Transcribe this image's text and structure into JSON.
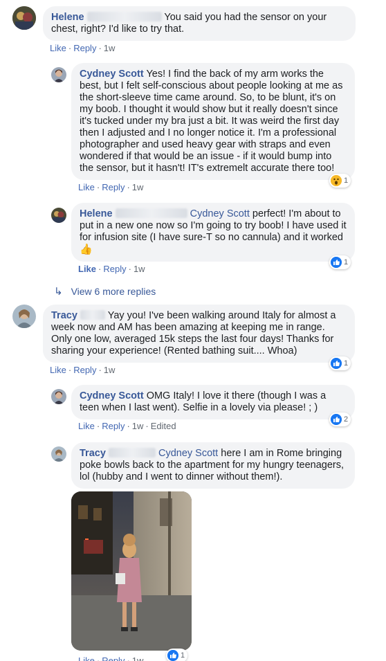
{
  "thread": {
    "c1": {
      "author": "Helene",
      "text": "You said you had the sensor on your chest, right? I'd like to try that.",
      "actions": [
        "Like",
        "Reply"
      ],
      "time": "1w"
    },
    "c2": {
      "author": "Cydney Scott",
      "text": "Yes! I find the back of my arm works the best, but I felt self-conscious about people looking at me as the short-sleeve time came around. So, to be blunt, it's on my boob. I thought it would show but it really doesn't since it's tucked under my bra just a bit. It was weird the first day then I adjusted and I no longer notice it. I'm a professional photographer and used heavy gear with straps and even wondered if that would be an issue - if it would bump into the sensor, but it hasn't! IT's extremelt accurate there too!",
      "actions": [
        "Like",
        "Reply"
      ],
      "time": "1w",
      "reaction": {
        "type": "wow",
        "count": "1"
      }
    },
    "c3": {
      "author": "Helene",
      "mention": "Cydney Scott",
      "text": "perfect! I'm about to put in a new one now so I'm going to try boob! I have used it for infusion site (I have sure-T so no cannula) and it worked",
      "emoji": "👍",
      "actions": [
        "Like",
        "Reply"
      ],
      "time": "1w",
      "reaction": {
        "type": "like",
        "count": "1"
      }
    },
    "view_more": "View 6 more replies",
    "c4": {
      "author": "Tracy",
      "text": "Yay you! I've been walking around Italy for almost a week now and AM has been amazing at keeping me in range. Only one low, averaged 15k steps the last four days! Thanks for sharing your experience! (Rented bathing suit.... Whoa)",
      "actions": [
        "Like",
        "Reply"
      ],
      "time": "1w",
      "reaction": {
        "type": "like",
        "count": "1"
      }
    },
    "c5": {
      "author": "Cydney Scott",
      "text": "OMG Italy! I love it there (though I was a teen when I last went). Selfie in a lovely via please! ; )",
      "actions": [
        "Like",
        "Reply"
      ],
      "time": "1w",
      "edited": "Edited",
      "reaction": {
        "type": "like",
        "count": "2"
      }
    },
    "c6": {
      "author": "Tracy",
      "mention": "Cydney Scott",
      "text": "here I am in Rome bringing poke bowls back to the apartment for my hungry teenagers, lol (hubby and I went to dinner without them!).",
      "actions": [
        "Like",
        "Reply"
      ],
      "time": "1w",
      "reaction": {
        "type": "like",
        "count": "1"
      }
    }
  },
  "colors": {
    "link": "#385898",
    "action_link": "#4267b2",
    "bubble": "#f2f3f5",
    "like_blue": "#1877f2",
    "wow_yellow": "#f7b928"
  },
  "icons": [
    "reply-arrow-icon",
    "like-reaction-icon",
    "wow-reaction-icon",
    "thumbs-up-emoji"
  ]
}
